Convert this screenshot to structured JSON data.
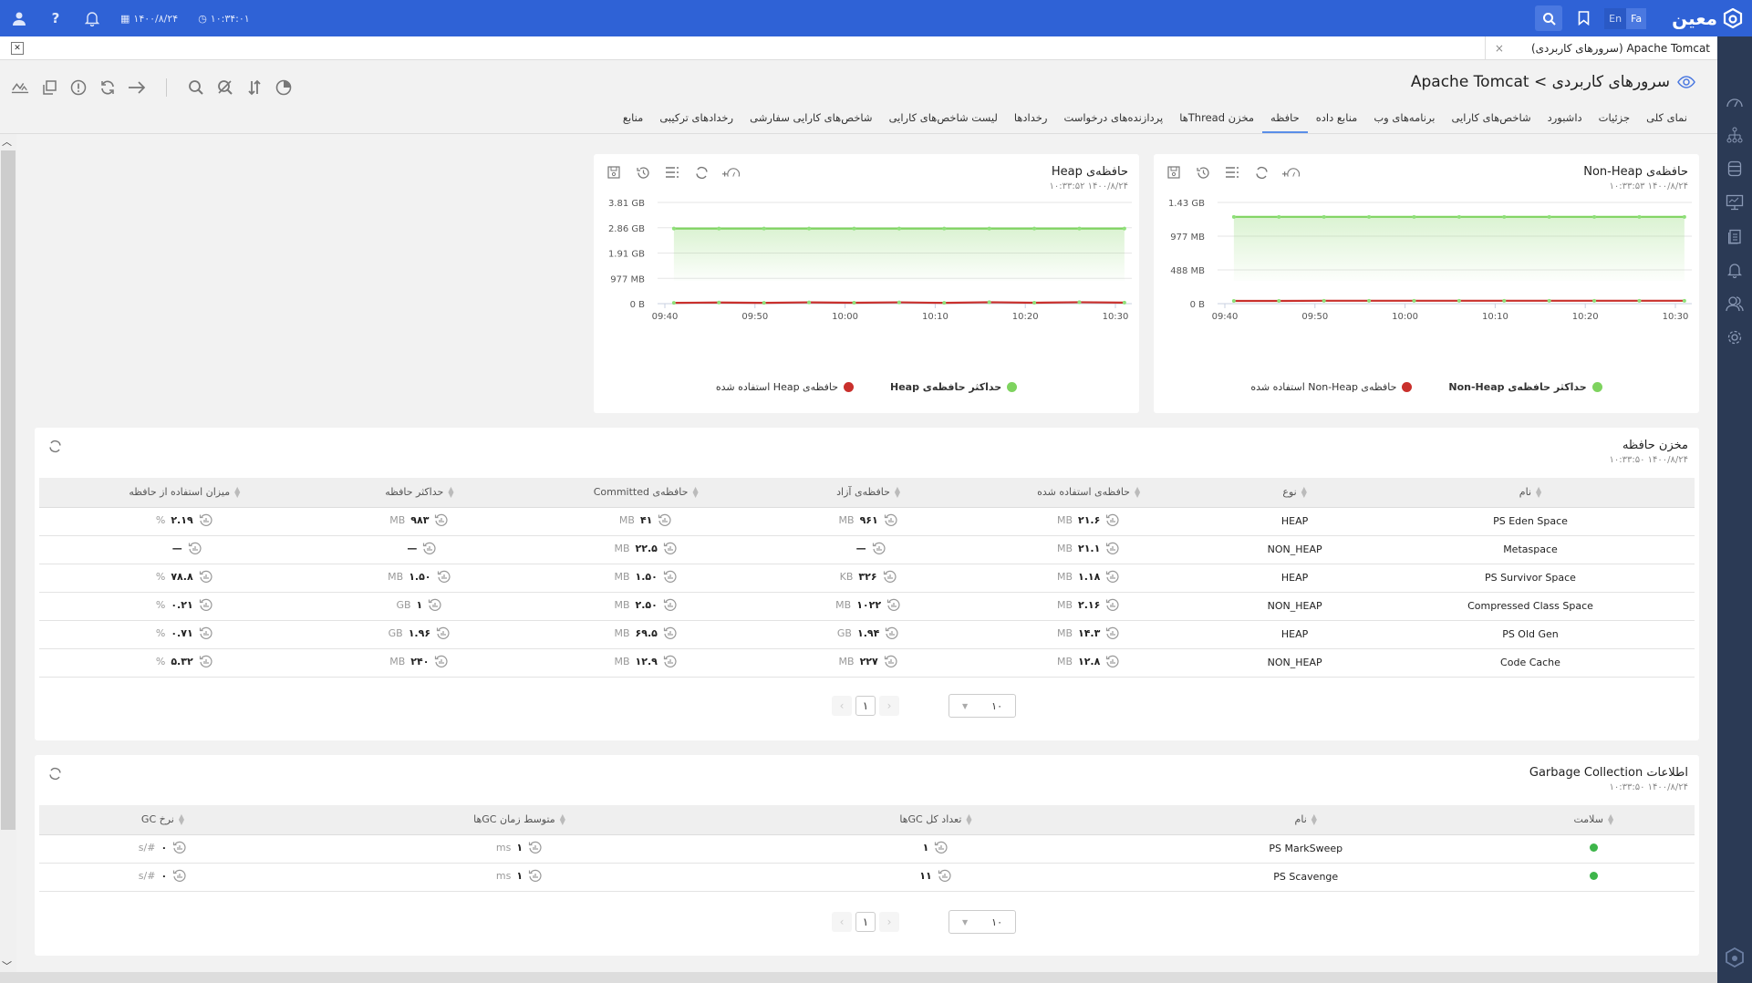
{
  "topbar": {
    "date": "۱۴۰۰/۸/۲۴",
    "time": "۱۰:۳۴:۰۱",
    "lang_en": "En",
    "lang_fa": "Fa",
    "logo_text": "معین",
    "icons": [
      "user-icon",
      "help-icon",
      "bell-icon",
      "calendar-icon",
      "clock-icon",
      "search-icon",
      "bookmark-icon"
    ]
  },
  "open_tab": {
    "label": "Apache Tomcat (سرورهای کاربردی)",
    "close": "×"
  },
  "page": {
    "title": "سرورهای کاربردی > Apache Tomcat"
  },
  "nav_tabs": [
    {
      "label": "نمای کلی",
      "active": false
    },
    {
      "label": "جزئیات",
      "active": false
    },
    {
      "label": "داشبورد",
      "active": false
    },
    {
      "label": "شاخص‌های کارایی",
      "active": false
    },
    {
      "label": "برنامه‌های وب",
      "active": false
    },
    {
      "label": "منابع داده",
      "active": false
    },
    {
      "label": "حافظه",
      "active": true
    },
    {
      "label": "مخزن Threadها",
      "active": false
    },
    {
      "label": "پردازنده‌های درخواست",
      "active": false
    },
    {
      "label": "رخدادها",
      "active": false
    },
    {
      "label": "لیست شاخص‌های کارایی",
      "active": false
    },
    {
      "label": "شاخص‌های کارایی سفارشی",
      "active": false
    },
    {
      "label": "رخدادهای ترکیبی",
      "active": false
    },
    {
      "label": "منابع",
      "active": false
    }
  ],
  "colors": {
    "primary": "#2f62d6",
    "sidebar": "#2b3a55",
    "max_series": "#7ed35f",
    "used_series": "#c9302c",
    "healthy": "#3db54a"
  },
  "chart_data": [
    {
      "type": "area",
      "title": "حافظه‌ی Non-Heap",
      "timestamp": "۱۴۰۰/۸/۲۴   ۱۰:۳۳:۵۳",
      "x": [
        "09:41",
        "09:46",
        "09:51",
        "09:56",
        "10:01",
        "10:06",
        "10:11",
        "10:16",
        "10:21",
        "10:26",
        "10:31"
      ],
      "xticks": [
        "09:40",
        "09:50",
        "10:00",
        "10:10",
        "10:20",
        "10:30"
      ],
      "yticks": [
        "0 B",
        "488 MB",
        "977 MB",
        "1.43 GB"
      ],
      "ylim_mb": [
        0,
        1465
      ],
      "series": [
        {
          "name": "حداکثر حافظه‌ی Non-Heap",
          "color": "#7ed35f",
          "values_mb": [
            1256,
            1256,
            1256,
            1256,
            1256,
            1256,
            1256,
            1256,
            1256,
            1256,
            1256
          ]
        },
        {
          "name": "حافظه‌ی Non-Heap استفاده شده",
          "color": "#c9302c",
          "values_mb": [
            40,
            40,
            42,
            42,
            42,
            42,
            42,
            42,
            42,
            42,
            42
          ]
        }
      ],
      "legend": "bottom"
    },
    {
      "type": "area",
      "title": "حافظه‌ی Heap",
      "timestamp": "۱۴۰۰/۸/۲۴   ۱۰:۳۳:۵۲",
      "x": [
        "09:41",
        "09:46",
        "09:51",
        "09:56",
        "10:01",
        "10:06",
        "10:11",
        "10:16",
        "10:21",
        "10:26",
        "10:31"
      ],
      "xticks": [
        "09:40",
        "09:50",
        "10:00",
        "10:10",
        "10:20",
        "10:30"
      ],
      "yticks": [
        "0 B",
        "977 MB",
        "1.91 GB",
        "2.86 GB",
        "3.81 GB"
      ],
      "ylim_mb": [
        0,
        3906
      ],
      "series": [
        {
          "name": "حداکثر حافظه‌ی Heap",
          "color": "#7ed35f",
          "values_mb": [
            2900,
            2900,
            2900,
            2900,
            2900,
            2900,
            2900,
            2900,
            2900,
            2900,
            2900
          ]
        },
        {
          "name": "حافظه‌ی Heap استفاده شده",
          "color": "#c9302c",
          "values_mb": [
            30,
            45,
            30,
            50,
            35,
            50,
            30,
            55,
            35,
            55,
            40
          ]
        }
      ],
      "legend": "bottom"
    }
  ],
  "memory_pool": {
    "title": "مخزن حافظه",
    "timestamp": "۱۴۰۰/۸/۲۴   ۱۰:۳۳:۵۰",
    "columns": [
      "نام",
      "نوع",
      "حافظه‌ی استفاده شده",
      "حافظه‌ی آزاد",
      "حافظه‌ی Committed",
      "حداکثر حافظه",
      "میزان استفاده از حافظه"
    ],
    "rows": [
      {
        "name": "PS Eden Space",
        "type": "HEAP",
        "used": [
          "۲۱.۶",
          "MB"
        ],
        "free": [
          "۹۶۱",
          "MB"
        ],
        "committed": [
          "۴۱",
          "MB"
        ],
        "max": [
          "۹۸۳",
          "MB"
        ],
        "usage": [
          "۲.۱۹",
          "%"
        ]
      },
      {
        "name": "Metaspace",
        "type": "NON_HEAP",
        "used": [
          "۲۱.۱",
          "MB"
        ],
        "free": [
          "—",
          ""
        ],
        "committed": [
          "۲۲.۵",
          "MB"
        ],
        "max": [
          "—",
          ""
        ],
        "usage": [
          "—",
          ""
        ]
      },
      {
        "name": "PS Survivor Space",
        "type": "HEAP",
        "used": [
          "۱.۱۸",
          "MB"
        ],
        "free": [
          "۳۲۶",
          "KB"
        ],
        "committed": [
          "۱.۵۰",
          "MB"
        ],
        "max": [
          "۱.۵۰",
          "MB"
        ],
        "usage": [
          "۷۸.۸",
          "%"
        ]
      },
      {
        "name": "Compressed Class Space",
        "type": "NON_HEAP",
        "used": [
          "۲.۱۶",
          "MB"
        ],
        "free": [
          "۱۰۲۲",
          "MB"
        ],
        "committed": [
          "۲.۵۰",
          "MB"
        ],
        "max": [
          "۱",
          "GB"
        ],
        "usage": [
          "۰.۲۱",
          "%"
        ]
      },
      {
        "name": "PS Old Gen",
        "type": "HEAP",
        "used": [
          "۱۴.۳",
          "MB"
        ],
        "free": [
          "۱.۹۴",
          "GB"
        ],
        "committed": [
          "۶۹.۵",
          "MB"
        ],
        "max": [
          "۱.۹۶",
          "GB"
        ],
        "usage": [
          "۰.۷۱",
          "%"
        ]
      },
      {
        "name": "Code Cache",
        "type": "NON_HEAP",
        "used": [
          "۱۲.۸",
          "MB"
        ],
        "free": [
          "۲۲۷",
          "MB"
        ],
        "committed": [
          "۱۲.۹",
          "MB"
        ],
        "max": [
          "۲۴۰",
          "MB"
        ],
        "usage": [
          "۵.۳۲",
          "%"
        ]
      }
    ],
    "pager": {
      "page": "۱",
      "page_size": "۱۰"
    }
  },
  "gc": {
    "title": "اطلاعات Garbage Collection",
    "timestamp": "۱۴۰۰/۸/۲۴   ۱۰:۳۳:۵۰",
    "columns": [
      "سلامت",
      "نام",
      "تعداد کل GCها",
      "متوسط زمان GCها",
      "نرخ GC"
    ],
    "rows": [
      {
        "name": "PS MarkSweep",
        "count": "۱",
        "avg": [
          "۱",
          "ms"
        ],
        "rate": [
          "۰",
          "#/s"
        ]
      },
      {
        "name": "PS Scavenge",
        "count": "۱۱",
        "avg": [
          "۱",
          "ms"
        ],
        "rate": [
          "۰",
          "#/s"
        ]
      }
    ],
    "pager": {
      "page": "۱",
      "page_size": "۱۰"
    }
  }
}
